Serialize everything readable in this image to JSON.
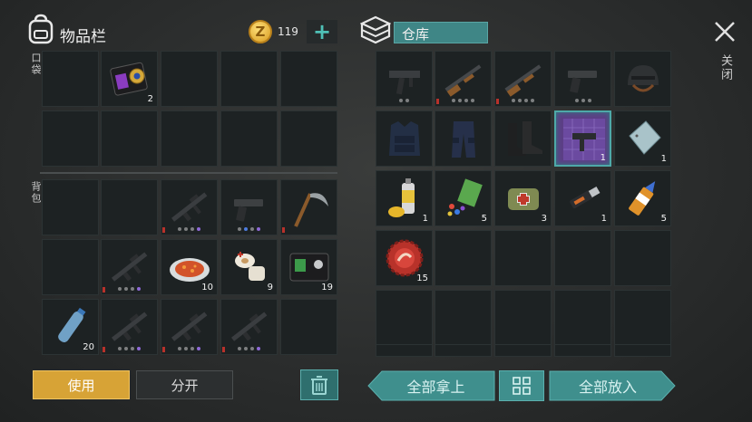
{
  "inventory": {
    "title": "物品栏",
    "pocket_label": "口袋",
    "backpack_label": "背包"
  },
  "currency": {
    "amount": "119",
    "coin_glyph": "Z",
    "add_glyph": "+"
  },
  "storage": {
    "title": "仓库",
    "close_label": "关闭"
  },
  "pocket_counts": {
    "badge": "2"
  },
  "backpack_counts": {
    "food": "10",
    "bandage": "9",
    "id_card": "19",
    "water": "20"
  },
  "storage_counts": {
    "uzi": "1",
    "steel_plate": "1",
    "spray": "1",
    "gems": "5",
    "medkit": "3",
    "usb": "1",
    "glue": "5",
    "bottle_cap": "15"
  },
  "buttons": {
    "use": "使用",
    "split": "分开",
    "take_all": "全部拿上",
    "put_all": "全部放入"
  },
  "colors": {
    "accent_teal": "#3f8f8d",
    "use_button": "#d7a336",
    "background": "#2c2e2e"
  }
}
